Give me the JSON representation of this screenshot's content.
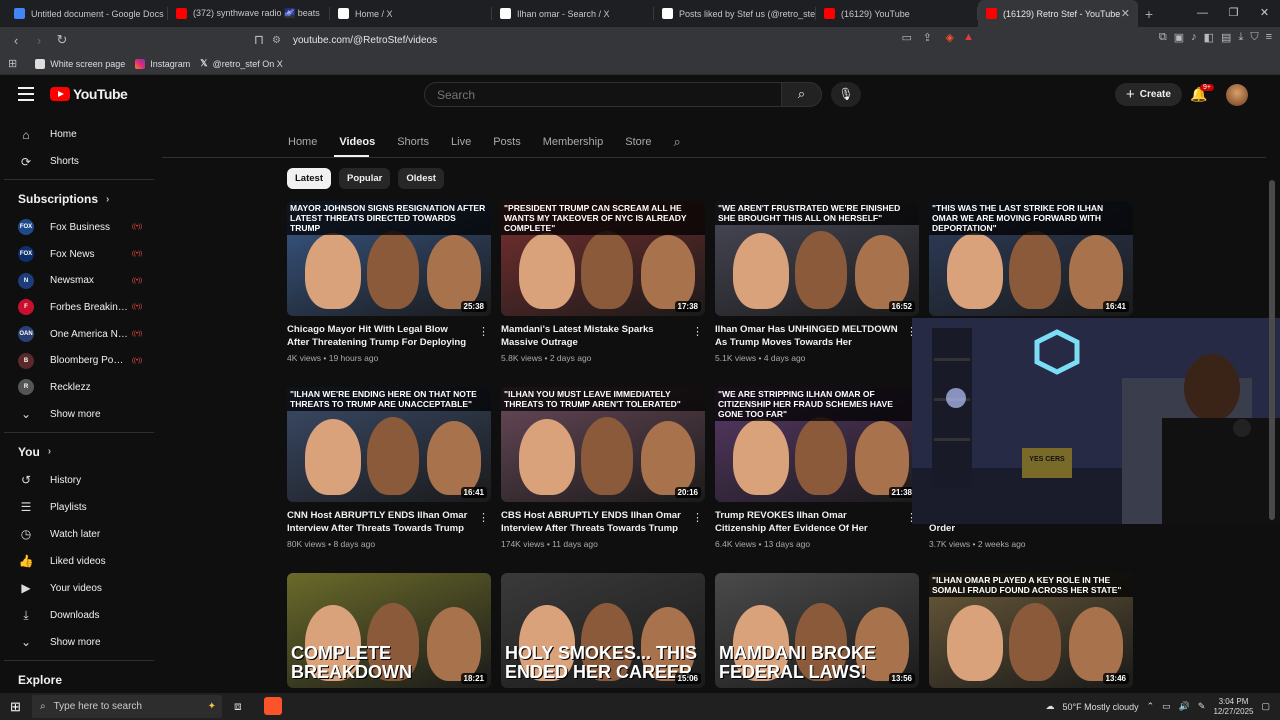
{
  "browser": {
    "tabs": [
      {
        "title": "Untitled document - Google Docs",
        "color": "#4285f4"
      },
      {
        "title": "(372) synthwave radio 🌌 beats",
        "color": "#ff0000"
      },
      {
        "title": "Home / X",
        "color": "#ffffff"
      },
      {
        "title": "Ilhan omar - Search / X",
        "color": "#ffffff"
      },
      {
        "title": "Posts liked by Stef us (@retro_stef) /",
        "color": "#ffffff"
      },
      {
        "title": "(16129) YouTube",
        "color": "#ff0000"
      },
      {
        "title": "(16129) Retro Stef - YouTube",
        "color": "#ff0000"
      }
    ],
    "url": "youtube.com/@RetroStef/videos",
    "bookmarks": [
      "White screen page",
      "Instagram",
      "@retro_stef On X"
    ]
  },
  "header": {
    "logo_text": "YouTube",
    "search_placeholder": "Search",
    "create_label": "Create",
    "notif_count": "9+"
  },
  "sidebar": {
    "main": [
      {
        "label": "Home",
        "icon": "home-icon",
        "glyph": "⌂"
      },
      {
        "label": "Shorts",
        "icon": "shorts-icon",
        "glyph": "⟳"
      }
    ],
    "subscriptions_title": "Subscriptions",
    "subscriptions": [
      {
        "name": "Fox Business",
        "color": "#1e4a8a",
        "abbr": "FOX",
        "live": true
      },
      {
        "name": "Fox News",
        "color": "#0d2f6b",
        "abbr": "FOX",
        "live": true
      },
      {
        "name": "Newsmax",
        "color": "#1c3c7a",
        "abbr": "N",
        "live": true
      },
      {
        "name": "Forbes Breaking ...",
        "color": "#c8102e",
        "abbr": "F",
        "live": true
      },
      {
        "name": "One America Ne...",
        "color": "#2a3f74",
        "abbr": "OAN",
        "live": true
      },
      {
        "name": "Bloomberg Podc...",
        "color": "#5a2a2a",
        "abbr": "B",
        "live": true
      },
      {
        "name": "Recklezz",
        "color": "#555555",
        "abbr": "R",
        "live": false
      }
    ],
    "show_more": "Show more",
    "you_title": "You",
    "you_items": [
      {
        "label": "History",
        "icon": "history-icon",
        "glyph": "↺"
      },
      {
        "label": "Playlists",
        "icon": "playlists-icon",
        "glyph": "☰"
      },
      {
        "label": "Watch later",
        "icon": "watch-later-icon",
        "glyph": "◷"
      },
      {
        "label": "Liked videos",
        "icon": "like-icon",
        "glyph": "👍"
      },
      {
        "label": "Your videos",
        "icon": "your-videos-icon",
        "glyph": "▶"
      },
      {
        "label": "Downloads",
        "icon": "download-icon",
        "glyph": "⤓"
      },
      {
        "label": "Show more",
        "icon": "chevron-down-icon",
        "glyph": "⌄"
      }
    ],
    "explore_title": "Explore"
  },
  "channel_tabs": [
    "Home",
    "Videos",
    "Shorts",
    "Live",
    "Posts",
    "Membership",
    "Store"
  ],
  "active_tab": "Videos",
  "chips": [
    "Latest",
    "Popular",
    "Oldest"
  ],
  "videos": [
    {
      "headline": "Mayor Johnson signs resignation after latest threats directed towards Trump",
      "duration": "25:38",
      "title": "Chicago Mayor Hit With Legal Blow After Threatening Trump For Deploying Marines",
      "views": "4K views",
      "age": "19 hours ago",
      "bg": "#3a5a8a"
    },
    {
      "headline": "\"President Trump can scream all he wants my takeover of NYC is already complete\"",
      "duration": "17:38",
      "title": "Mamdani's Latest Mistake Sparks Massive Outrage",
      "views": "5.8K views",
      "age": "2 days ago",
      "bg": "#7a3030"
    },
    {
      "headline": "\"We aren't frustrated we're finished she brought this all on herself\"",
      "duration": "16:52",
      "title": "Ilhan Omar Has UNHINGED MELTDOWN As Trump Moves Towards Her EXPULSION",
      "views": "5.1K views",
      "age": "4 days ago",
      "bg": "#4a4a5a"
    },
    {
      "headline": "\"This was the last strike for Ilhan Omar we are moving forward with deportation\"",
      "duration": "16:41",
      "title": "",
      "views": "",
      "age": "",
      "bg": "#2f3f5f"
    },
    {
      "headline": "\"Ilhan we're ending here on that note threats to Trump are unacceptable\"",
      "duration": "16:41",
      "title": "CNN Host ABRUPTLY ENDS Ilhan Omar Interview After Threats Towards Trump",
      "views": "80K views",
      "age": "8 days ago",
      "bg": "#3b4c6a"
    },
    {
      "headline": "\"Ilhan you must leave immediately threats to Trump aren't tolerated\"",
      "duration": "20:16",
      "title": "CBS Host ABRUPTLY ENDS Ilhan Omar Interview After Threats Towards Trump",
      "views": "174K views",
      "age": "11 days ago",
      "bg": "#6a4a5a"
    },
    {
      "headline": "\"We are stripping Ilhan Omar of citizenship her fraud schemes have gone too far\"",
      "duration": "21:38",
      "title": "Trump REVOKES Ilhan Omar Citizenship After Evidence Of Her Facilitating Fraud...",
      "views": "6.4K views",
      "age": "13 days ago",
      "bg": "#5a3a6a"
    },
    {
      "headline": "",
      "duration": "",
      "title": "Judge After FIGHTING Deportation Order",
      "views": "3.7K views",
      "age": "2 weeks ago",
      "bg": "#2f3f5f"
    },
    {
      "headline": "",
      "big": "COMPLETE BREAKDOWN",
      "duration": "18:21",
      "title": "",
      "views": "",
      "age": "",
      "bg": "#6a6a2a"
    },
    {
      "headline": "",
      "big": "HOLY SMOKES... THIS ENDED HER CAREER",
      "duration": "15:06",
      "title": "",
      "views": "",
      "age": "",
      "bg": "#3a3a3a"
    },
    {
      "headline": "",
      "big": "MAMDANI BROKE FEDERAL LAWS!",
      "duration": "13:56",
      "title": "",
      "views": "",
      "age": "",
      "bg": "#4a4a4a"
    },
    {
      "headline": "\"Ilhan Omar played a key role in the Somali fraud found across her state\"",
      "duration": "13:46",
      "title": "",
      "views": "",
      "age": "",
      "bg": "#6a5a3a"
    }
  ],
  "webcam": {
    "sign_text": "YES CERS"
  },
  "taskbar": {
    "search_placeholder": "Type here to search",
    "weather": "50°F  Mostly cloudy",
    "time": "3:04 PM",
    "date": "12/27/2025"
  }
}
